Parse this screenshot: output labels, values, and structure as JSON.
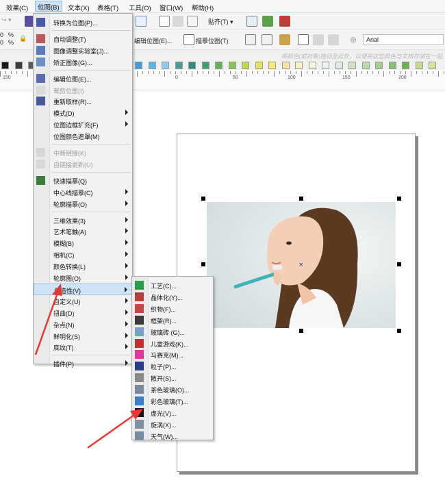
{
  "menubar": [
    "效果(C)",
    "位图(B)",
    "文本(X)",
    "表格(T)",
    "工具(O)",
    "窗口(W)",
    "帮助(H)"
  ],
  "toolbar1": {
    "snap_label": "贴齐(T)"
  },
  "toolbar2": {
    "num1": "0",
    "num2": "0",
    "unit1": "%",
    "unit2": "%",
    "edit_bitmap": "编辑位图(E)...",
    "trace_bitmap": "描摹位图(T)",
    "font": "Arial"
  },
  "hint_text": "将颜色(或对象)拖动至此处，以便将这些颜色与文档存储在一起",
  "colors": {
    "accent": "#cde3f7",
    "arrow": "#e53935"
  },
  "palette": [
    "#1a1a1a",
    "#3c3c3c",
    "#5a5a5a",
    "#777777",
    "#949494",
    "#b1b1b1",
    "#2b2e8c",
    "#1f3f9c",
    "#1463b3",
    "#2f7fd0",
    "#3aa0e0",
    "#58b8ec",
    "#8fc9f0",
    "#4a9b96",
    "#2f8a7c",
    "#3d9f6c",
    "#5fb15c",
    "#8cc44f",
    "#b7d84a",
    "#e1e64e",
    "#f4ee6a",
    "#f7e4a2",
    "#f1f4c1",
    "#f5f7dc",
    "#eef3f0",
    "#dfe9e0",
    "#d5dfc8",
    "#c0d7b0",
    "#a7cc8e",
    "#8abf6f",
    "#6aaf50",
    "#c9d98a",
    "#d8e49a"
  ],
  "ruler_labels": [
    "150",
    "0",
    "50",
    "100",
    "150",
    "200"
  ],
  "bitmap_menu": [
    {
      "label": "转换为位图(P)...",
      "icon": "convert-bitmap-icon",
      "dis": false,
      "sub": false
    },
    {
      "sep": true
    },
    {
      "label": "自动调整(T)",
      "icon": "auto-adjust-icon",
      "dis": false,
      "sub": false
    },
    {
      "label": "图像调整实验室(J)...",
      "icon": "image-lab-icon",
      "dis": false,
      "sub": false
    },
    {
      "label": "矫正图像(G)...",
      "icon": "straighten-icon",
      "dis": false,
      "sub": false
    },
    {
      "sep": true
    },
    {
      "label": "编辑位图(E)...",
      "icon": "edit-bitmap-icon",
      "dis": false,
      "sub": false
    },
    {
      "label": "裁剪位图(I)",
      "icon": "crop-bitmap-icon",
      "dis": true,
      "sub": false
    },
    {
      "label": "重新取样(R)...",
      "icon": "resample-icon",
      "dis": false,
      "sub": false
    },
    {
      "label": "模式(D)",
      "icon": "",
      "dis": false,
      "sub": true
    },
    {
      "label": "位图边框扩充(F)",
      "icon": "",
      "dis": false,
      "sub": true
    },
    {
      "label": "位图颜色遮罩(M)",
      "icon": "",
      "dis": false,
      "sub": false
    },
    {
      "sep": true
    },
    {
      "label": "中断链接(K)",
      "icon": "break-link-icon",
      "dis": true,
      "sub": false
    },
    {
      "label": "自链接更新(U)",
      "icon": "update-link-icon",
      "dis": true,
      "sub": false
    },
    {
      "sep": true
    },
    {
      "label": "快速描摹(Q)",
      "icon": "quick-trace-icon",
      "dis": false,
      "sub": false
    },
    {
      "label": "中心线描摹(C)",
      "icon": "",
      "dis": false,
      "sub": true
    },
    {
      "label": "轮廓描摹(O)",
      "icon": "",
      "dis": false,
      "sub": true
    },
    {
      "sep": true
    },
    {
      "label": "三维效果(3)",
      "icon": "",
      "dis": false,
      "sub": true
    },
    {
      "label": "艺术笔触(A)",
      "icon": "",
      "dis": false,
      "sub": true
    },
    {
      "label": "模糊(B)",
      "icon": "",
      "dis": false,
      "sub": true
    },
    {
      "label": "相机(C)",
      "icon": "",
      "dis": false,
      "sub": true
    },
    {
      "label": "颜色转换(L)",
      "icon": "",
      "dis": false,
      "sub": true
    },
    {
      "label": "轮廓图(O)",
      "icon": "",
      "dis": false,
      "sub": true
    },
    {
      "label": "创造性(V)",
      "icon": "",
      "dis": false,
      "sub": true,
      "hl": true
    },
    {
      "label": "自定义(U)",
      "icon": "",
      "dis": false,
      "sub": true
    },
    {
      "label": "扭曲(D)",
      "icon": "",
      "dis": false,
      "sub": true
    },
    {
      "label": "杂点(N)",
      "icon": "",
      "dis": false,
      "sub": true
    },
    {
      "label": "鲜明化(S)",
      "icon": "",
      "dis": false,
      "sub": true
    },
    {
      "label": "底纹(T)",
      "icon": "",
      "dis": false,
      "sub": true
    },
    {
      "sep": true
    },
    {
      "label": "插件(P)",
      "icon": "",
      "dis": false,
      "sub": true
    }
  ],
  "creative_menu": [
    {
      "label": "工艺(C)...",
      "icon": "crafts-icon"
    },
    {
      "label": "晶体化(Y)...",
      "icon": "crystallize-icon"
    },
    {
      "label": "织物(F)...",
      "icon": "fabric-icon"
    },
    {
      "label": "框架(R)...",
      "icon": "frame-icon"
    },
    {
      "label": "玻璃砖 (G)...",
      "icon": "glass-block-icon"
    },
    {
      "label": "儿童游戏(K)...",
      "icon": "kids-play-icon"
    },
    {
      "label": "马赛克(M)...",
      "icon": "mosaic-icon"
    },
    {
      "label": "粒子(P)...",
      "icon": "particles-icon"
    },
    {
      "label": "散开(S)...",
      "icon": "scatter-icon"
    },
    {
      "label": "茶色玻璃(O)...",
      "icon": "smoked-glass-icon"
    },
    {
      "label": "彩色玻璃(T)...",
      "icon": "stained-glass-icon"
    },
    {
      "label": "虚光(V)...",
      "icon": "vignette-icon"
    },
    {
      "label": "旋涡(X)...",
      "icon": "vortex-icon"
    },
    {
      "label": "天气(W)...",
      "icon": "weather-icon"
    }
  ]
}
